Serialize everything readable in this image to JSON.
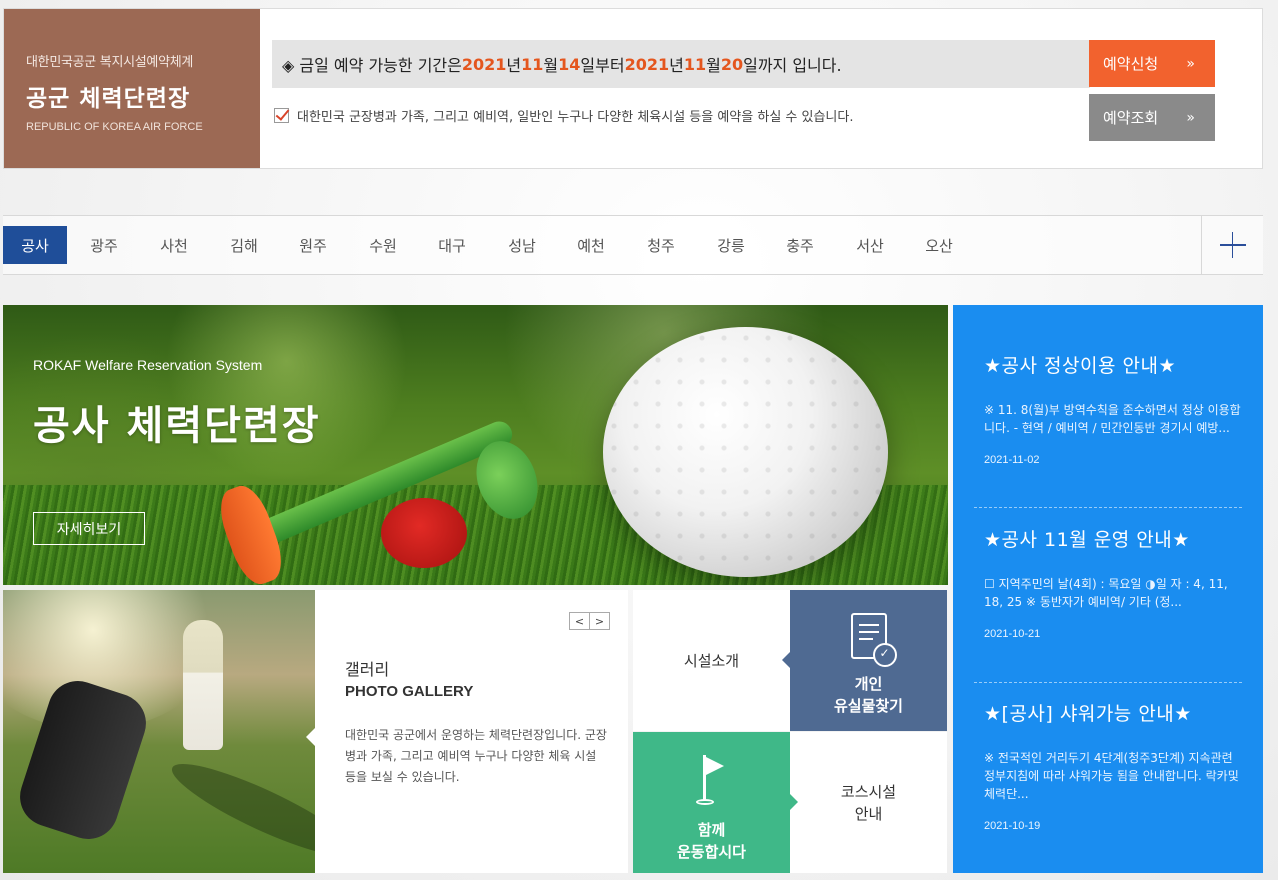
{
  "brand": {
    "line1": "대한민국공군 복지시설예약체계",
    "title": "공군 체력단련장",
    "english": "REPUBLIC OF KOREA AIR FORCE"
  },
  "period": {
    "prefix": "◈ 금일 예약 가능한 기간은 ",
    "y1": "2021",
    "t1": "년 ",
    "m1": "11",
    "t2": "월 ",
    "d1": "14",
    "t3": "일부터 ",
    "y2": "2021",
    "t4": "년 ",
    "m2": "11",
    "t5": "월 ",
    "d2": "20",
    "t6": "일까지 입니다."
  },
  "notice": "대한민국 군장병과 가족, 그리고 예비역, 일반인 누구나 다양한 체육시설 등을 예약을 하실 수 있습니다.",
  "buttons": {
    "apply": "예약신청",
    "check": "예약조회",
    "arrow": "»"
  },
  "tabs": [
    "공사",
    "광주",
    "사천",
    "김해",
    "원주",
    "수원",
    "대구",
    "성남",
    "예천",
    "청주",
    "강릉",
    "충주",
    "서산",
    "오산"
  ],
  "active_tab": "공사",
  "hero": {
    "subtitle": "ROKAF Welfare Reservation System",
    "title": "공사 체력단련장",
    "button": "자세히보기"
  },
  "gallery": {
    "title_ko": "갤러리",
    "title_en": "PHOTO GALLERY",
    "description": "대한민국 공군에서 운영하는 체력단련장입니다. 군장병과 가족, 그리고 예비역 누구나 다양한 체육 시설 등을 보실 수 있습니다.",
    "prev": "<",
    "next": ">"
  },
  "quick_links": {
    "facility": "시설소개",
    "lost_line1": "개인",
    "lost_line2": "유실물찾기",
    "together_line1": "함께",
    "together_line2": "운동합시다",
    "course_line1": "코스시설",
    "course_line2": "안내"
  },
  "news": [
    {
      "title": "★공사 정상이용 안내★",
      "desc": "※ 11. 8(월)부 방역수칙을 준수하면서 정상 이용합니다. - 현역 / 예비역 / 민간인동반 경기시 예방...",
      "date": "2021-11-02"
    },
    {
      "title": "★공사 11월 운영 안내★",
      "desc": "☐ 지역주민의 날(4회) : 목요일 ◑일 자 : 4, 11, 18, 25 ※ 동반자가 예비역/ 기타 (정...",
      "date": "2021-10-21"
    },
    {
      "title": "★[공사] 샤워가능 안내★",
      "desc": "※ 전국적인 거리두기 4단계(청주3단계) 지속관련 정부지침에 따라 샤워가능 됨을 안내합니다. 락카및 체력단...",
      "date": "2021-10-19"
    }
  ],
  "colors": {
    "brand_bg": "#9c6954",
    "accent_orange": "#f2622e",
    "tab_active": "#1f4e99",
    "news_bg": "#1a8df0",
    "lost_bg": "#4f6a92",
    "together_bg": "#3fb888"
  },
  "icons": [
    "checkbox-checked-icon",
    "chevron-double-right-icon",
    "plus-icon",
    "document-check-icon",
    "golf-flag-icon"
  ]
}
